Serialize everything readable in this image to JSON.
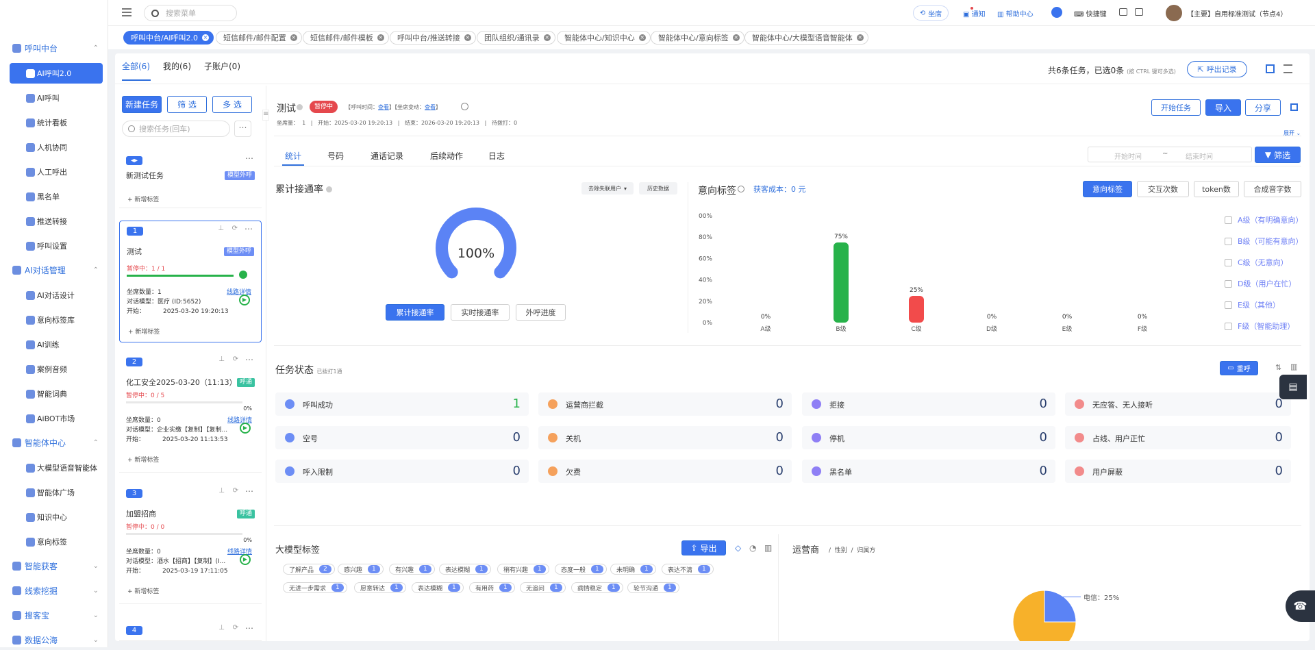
{
  "sidebar": {
    "groups": [
      {
        "label": "呼叫中台",
        "items": [
          "AI呼叫2.0",
          "AI呼叫",
          "统计看板",
          "人机协同",
          "人工呼出",
          "黑名单",
          "推送转接",
          "呼叫设置"
        ]
      },
      {
        "label": "AI对话管理",
        "items": [
          "AI对话设计",
          "意向标签库",
          "AI训练",
          "案例音频",
          "智能词典",
          "AiBOT市场"
        ]
      },
      {
        "label": "智能体中心",
        "items": [
          "大模型语音智能体",
          "智能体广场",
          "知识中心",
          "意向标签"
        ]
      },
      {
        "label": "智能获客"
      },
      {
        "label": "线索挖掘"
      },
      {
        "label": "搜客宝"
      },
      {
        "label": "数据公海"
      }
    ]
  },
  "topbar": {
    "search_placeholder": "搜索菜单",
    "seat": "坐席",
    "notify": "通知",
    "help": "帮助中心",
    "shortcut": "快捷键",
    "user": "【主要】自用标准测试（节点4）"
  },
  "tabs": [
    "呼叫中台/AI呼叫2.0",
    "短信邮件/邮件配置",
    "短信邮件/邮件模板",
    "呼叫中台/推送转接",
    "团队组织/通讯录",
    "智能体中心/知识中心",
    "智能体中心/意向标签",
    "智能体中心/大模型语音智能体"
  ],
  "filter": {
    "tabs": [
      "全部(6)",
      "我的(6)",
      "子账户(0)"
    ],
    "summary": "共6条任务，已选0条",
    "hint": "(按 CTRL 键可多选)",
    "export_records": "呼出记录"
  },
  "tasklist": {
    "new_btn": "新建任务",
    "filter_btn": "筛 选",
    "multi_btn": "多 选",
    "search_placeholder": "搜索任务(回车)",
    "add_tag": "+ 新增标签",
    "num_label": "坐席数量：",
    "model_label": "对话模型：",
    "start_label": "开始：",
    "detail_link": "线路详情",
    "cards": [
      {
        "num": "",
        "title": "新测试任务",
        "tag": "模型外呼"
      },
      {
        "num": "1",
        "title": "测试",
        "tag": "模型外呼",
        "status": "暂停中：1 / 1",
        "seats": "1",
        "model": "医疗 (ID:5652)",
        "start": "2025-03-20 19:20:13",
        "progress": 100
      },
      {
        "num": "2",
        "title": "化工安全2025-03-20（11:13）",
        "tag": "呼通",
        "status": "暂停中：0 / 5",
        "seats": "0",
        "model": "企业实缴【复制】【复制...",
        "start": "2025-03-20 11:13:53",
        "progress": 0,
        "pct": "0%"
      },
      {
        "num": "3",
        "title": "加盟招商",
        "tag": "呼通",
        "status": "暂停中：0 / 0",
        "seats": "0",
        "model": "酒水【招商】【复制】(I...",
        "start": "2025-03-19 17:11:05",
        "progress": 0,
        "pct": "0%"
      },
      {
        "num": "4"
      }
    ]
  },
  "detail": {
    "title": "测试",
    "status": "暂停中",
    "call_time": "【呼叫时间：",
    "call_time_link": "查看",
    "seat_change": "】【坐席变动：",
    "seat_change_link": "查看",
    "seat_change_end": "】",
    "meta": "坐席量：  1   |   开始：2025-03-20 19:20:13   |   结束：2026-03-20 19:20:13   |   待拨打：0",
    "btn_start": "开始任务",
    "btn_import": "导入",
    "btn_share": "分享",
    "expand": "展开",
    "tabs": [
      "统计",
      "号码",
      "通话记录",
      "后续动作",
      "日志"
    ],
    "start_placeholder": "开始时间",
    "sep": "~",
    "end_placeholder": "结束时间",
    "filter_btn": "筛选"
  },
  "connect": {
    "title": "累计接通率",
    "dropdown": "去除失联用户",
    "history": "历史数据",
    "value": "100%",
    "progress": 1.0,
    "btns": [
      "累计接通率",
      "实时接通率",
      "外呼进度"
    ]
  },
  "intent": {
    "title": "意向标签",
    "cost": "获客成本：0 元",
    "btns": [
      "意向标签",
      "交互次数",
      "token数",
      "合成音字数"
    ],
    "checks": [
      "A级（有明确意向）",
      "B级（可能有意向）",
      "C级（无意向）",
      "D级（用户在忙）",
      "E级（其他）",
      "F级（智能助理）"
    ]
  },
  "chart_data": {
    "type": "bar",
    "categories": [
      "A级",
      "B级",
      "C级",
      "D级",
      "E级",
      "F级"
    ],
    "values": [
      0,
      75,
      25,
      0,
      0,
      0
    ],
    "labels": [
      "0%",
      "75%",
      "25%",
      "0%",
      "0%",
      "0%"
    ],
    "colors": [
      "#27b24a",
      "#27b24a",
      "#f24b4b",
      "#27b24a",
      "#27b24a",
      "#27b24a"
    ],
    "yticks": [
      "100%",
      "80%",
      "60%",
      "40%",
      "20%",
      "0%"
    ],
    "ylim": [
      0,
      100
    ]
  },
  "taskstatus": {
    "title": "任务状态",
    "sub": "已拨打1通",
    "redial": "重呼",
    "items": [
      {
        "label": "呼叫成功",
        "value": "1",
        "color": "#6d8ef5"
      },
      {
        "label": "运营商拦截",
        "value": "0",
        "color": "#f5a15c"
      },
      {
        "label": "拒接",
        "value": "0",
        "color": "#8f7ff5"
      },
      {
        "label": "无应答、无人接听",
        "value": "0",
        "color": "#f28b8b"
      },
      {
        "label": "空号",
        "value": "0",
        "color": "#6d8ef5"
      },
      {
        "label": "关机",
        "value": "0",
        "color": "#f5a15c"
      },
      {
        "label": "停机",
        "value": "0",
        "color": "#8f7ff5"
      },
      {
        "label": "占线、用户正忙",
        "value": "0",
        "color": "#f28b8b"
      },
      {
        "label": "呼入限制",
        "value": "0",
        "color": "#6d8ef5"
      },
      {
        "label": "欠费",
        "value": "0",
        "color": "#f5a15c"
      },
      {
        "label": "黑名单",
        "value": "0",
        "color": "#8f7ff5"
      },
      {
        "label": "用户屏蔽",
        "value": "0",
        "color": "#f28b8b"
      }
    ]
  },
  "llm": {
    "title": "大模型标签",
    "export": "导出",
    "tags": [
      {
        "label": "了解产品",
        "count": "2"
      },
      {
        "label": "感兴趣",
        "count": "1"
      },
      {
        "label": "有兴趣",
        "count": "1"
      },
      {
        "label": "表达模糊",
        "count": "1"
      },
      {
        "label": "稍有兴趣",
        "count": "1"
      },
      {
        "label": "态度一般",
        "count": "1"
      },
      {
        "label": "未明确",
        "count": "1"
      },
      {
        "label": "表达不清",
        "count": "1"
      },
      {
        "label": "无进一步需求",
        "count": "1"
      },
      {
        "label": "愿意转达",
        "count": "1"
      },
      {
        "label": "表达模糊",
        "count": "1"
      },
      {
        "label": "有用药",
        "count": "1"
      },
      {
        "label": "无追问",
        "count": "1"
      },
      {
        "label": "病情稳定",
        "count": "1"
      },
      {
        "label": "轮节沟通",
        "count": "1"
      }
    ]
  },
  "carrier": {
    "title": "运营商",
    "tab2": "性别",
    "tab3": "归属方",
    "slice_label": "电信：25%",
    "slices": [
      {
        "label": "电信",
        "value": 25,
        "color": "#5b83f5"
      },
      {
        "label": "",
        "value": 75,
        "color": "#f7b12a"
      }
    ]
  }
}
